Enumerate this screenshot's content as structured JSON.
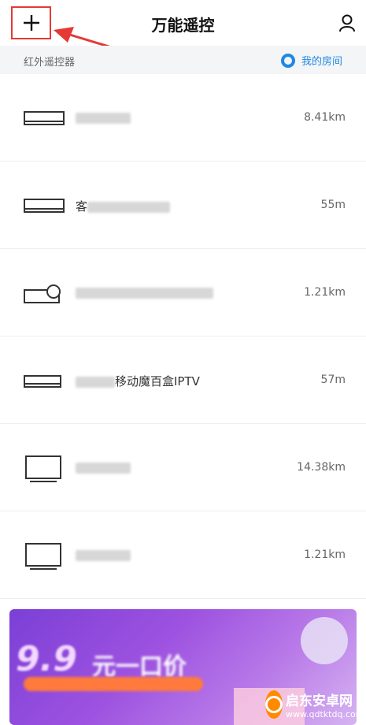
{
  "header": {
    "title": "万能遥控"
  },
  "subbar": {
    "label": "红外遥控器",
    "my_room": "我的房间"
  },
  "devices": [
    {
      "icon": "set-top-box-icon",
      "name_prefix": "",
      "name": "",
      "distance": "8.41km"
    },
    {
      "icon": "set-top-box-icon",
      "name_prefix": "客",
      "name": "",
      "distance": "55m"
    },
    {
      "icon": "projector-icon",
      "name_prefix": "",
      "name": "",
      "distance": "1.21km"
    },
    {
      "icon": "set-top-box-icon",
      "name_prefix": "",
      "name": "移动魔百盒IPTV",
      "distance": "57m"
    },
    {
      "icon": "tv-icon",
      "name_prefix": "",
      "name": "",
      "distance": "14.38km"
    },
    {
      "icon": "tv-icon",
      "name_prefix": "",
      "name": "",
      "distance": "1.21km"
    }
  ],
  "banner": {
    "big_text": "9.9",
    "text": "元一口价"
  },
  "watermark": {
    "title": "启东安卓网",
    "url": "www.qdtktdq.com"
  },
  "colors": {
    "accent": "#1e88e5",
    "highlight": "#e53935",
    "banner": "#8e44dd"
  }
}
